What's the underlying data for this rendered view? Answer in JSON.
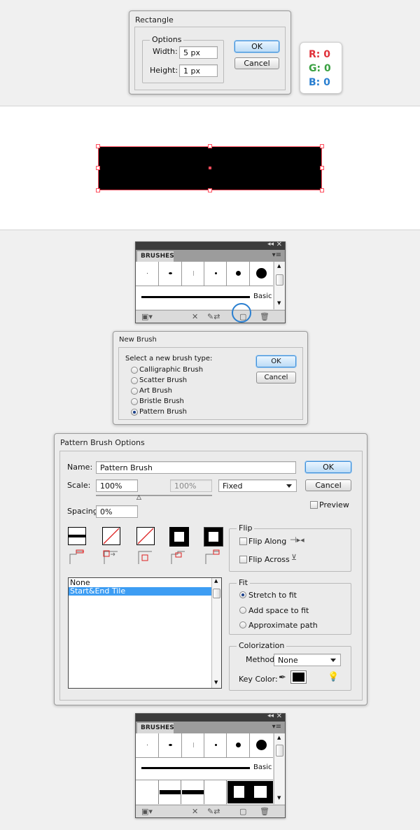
{
  "rect_dialog": {
    "title": "Rectangle",
    "options_label": "Options",
    "width_label": "Width:",
    "width_value": "5 px",
    "height_label": "Height:",
    "height_value": "1 px",
    "ok_label": "OK",
    "cancel_label": "Cancel"
  },
  "rgb_swatch": {
    "r": "R: 0",
    "g": "G: 0",
    "b": "B: 0",
    "r_color": "#e0323b",
    "g_color": "#3aa142",
    "b_color": "#2a7fd0"
  },
  "canvas": {
    "fill": "#000000",
    "selection_color": "#ff4a5a"
  },
  "brushes_panel_1": {
    "tab": "BRUSHES",
    "basic_label": "Basic"
  },
  "new_brush_dialog": {
    "title": "New Brush",
    "prompt": "Select a new brush type:",
    "options": [
      "Calligraphic Brush",
      "Scatter Brush",
      "Art Brush",
      "Bristle Brush",
      "Pattern Brush"
    ],
    "selected": "Pattern Brush",
    "ok_label": "OK",
    "cancel_label": "Cancel"
  },
  "pattern_dialog": {
    "title": "Pattern Brush Options",
    "name_label": "Name:",
    "name_value": "Pattern Brush",
    "ok_label": "OK",
    "cancel_label": "Cancel",
    "scale_label": "Scale:",
    "scale_value": "100%",
    "scale_value_2": "100%",
    "scale_mode": "Fixed",
    "spacing_label": "Spacing:",
    "spacing_value": "0%",
    "preview_label": "Preview",
    "flip_label": "Flip",
    "flip_along": "Flip Along",
    "flip_across": "Flip Across",
    "fit_label": "Fit",
    "fit_options": [
      "Stretch to fit",
      "Add space to fit",
      "Approximate path"
    ],
    "fit_selected": "Stretch to fit",
    "colorization_label": "Colorization",
    "method_label": "Method:",
    "method_value": "None",
    "key_color_label": "Key Color:",
    "tile_list": [
      "None",
      "Start&End Tile"
    ],
    "tile_selected": "Start&End Tile"
  },
  "brushes_panel_2": {
    "tab": "BRUSHES",
    "basic_label": "Basic"
  }
}
